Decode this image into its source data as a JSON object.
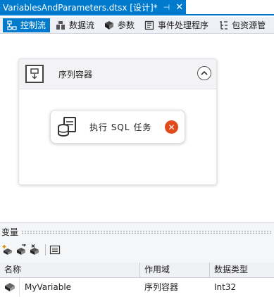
{
  "document_tab": {
    "title": "VariablesAndParameters.dtsx [设计]*",
    "pin_glyph": "⊣",
    "close_glyph": "✕"
  },
  "designer_tabs": [
    {
      "label": "控制流",
      "icon": "control-flow-icon",
      "active": true
    },
    {
      "label": "数据流",
      "icon": "data-flow-icon",
      "active": false
    },
    {
      "label": "参数",
      "icon": "parameters-icon",
      "active": false
    },
    {
      "label": "事件处理程序",
      "icon": "event-handlers-icon",
      "active": false
    },
    {
      "label": "包资源管",
      "icon": "package-explorer-icon",
      "active": false
    }
  ],
  "container": {
    "title": "序列容器",
    "icon": "sequence-container-icon",
    "collapse_icon": "collapse-up-icon"
  },
  "task": {
    "title": "执行 SQL 任务",
    "icon": "execute-sql-task-icon",
    "status_icon": "error-icon",
    "status_glyph": "✕"
  },
  "variables_pane": {
    "title": "变量",
    "toolbar": [
      "add-variable-icon",
      "move-variable-icon",
      "delete-variable-icon",
      "grid-options-icon"
    ],
    "columns": [
      "名称",
      "作用域",
      "数据类型"
    ],
    "rows": [
      {
        "name": "MyVariable",
        "scope": "序列容器",
        "type": "Int32"
      }
    ]
  },
  "colors": {
    "accent": "#007acc",
    "error": "#e14b1c"
  }
}
